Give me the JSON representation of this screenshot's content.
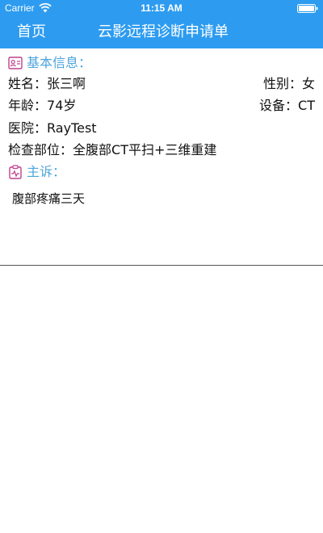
{
  "status_bar": {
    "carrier": "Carrier",
    "time": "11:15 AM"
  },
  "nav": {
    "home": "首页",
    "title": "云影远程诊断申请单"
  },
  "basic_info": {
    "heading": "基本信息：",
    "name_label": "姓名：",
    "name_value": "张三啊",
    "gender_label": "性别：",
    "gender_value": "女",
    "age_label": "年龄：",
    "age_value": "74岁",
    "device_label": "设备：",
    "device_value": "CT",
    "hospital_label": "医院：",
    "hospital_value": "RayTest",
    "exam_label": "检查部位：",
    "exam_value": "全腹部CT平扫+三维重建"
  },
  "complaint": {
    "heading": "主诉：",
    "text": "腹部疼痛三天"
  },
  "colors": {
    "nav_background": "#2d9cf0",
    "section_heading": "#4da5dc",
    "icon": "#c0408c"
  }
}
